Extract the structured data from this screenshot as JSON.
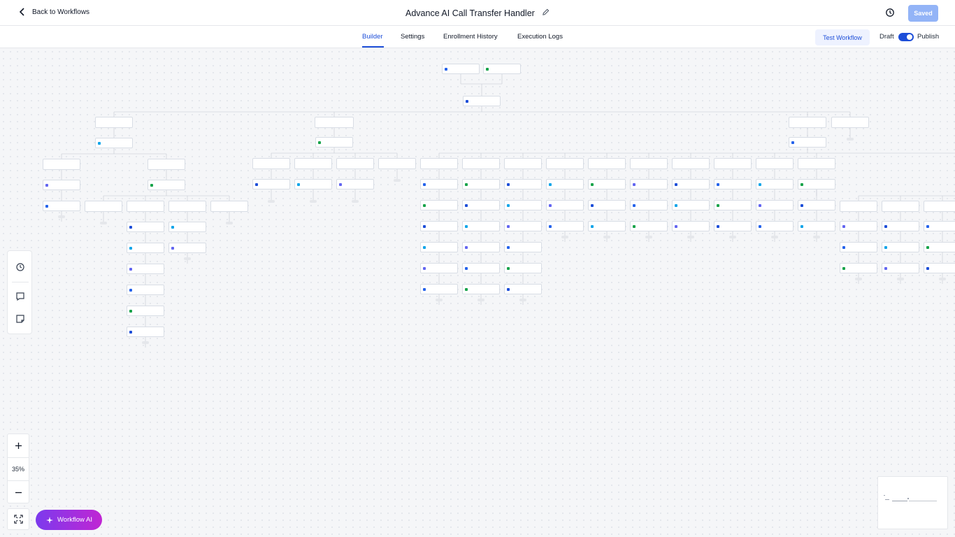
{
  "header": {
    "back_label": "Back to Workflows",
    "workflow_title": "Advance AI Call Transfer Handler",
    "saved_label": "Saved"
  },
  "tabs": [
    {
      "label": "Builder",
      "active": true
    },
    {
      "label": "Settings",
      "active": false
    },
    {
      "label": "Enrollment History",
      "active": false
    },
    {
      "label": "Execution Logs",
      "active": false
    }
  ],
  "actions": {
    "test_label": "Test Workflow",
    "draft_label": "Draft",
    "publish_label": "Publish",
    "published_toggle_on": true
  },
  "canvas": {
    "zoom_label": "35%",
    "zoom_in_icon": "plus-icon",
    "zoom_out_icon": "minus-icon"
  },
  "ai": {
    "label": "Workflow AI"
  },
  "colors": {
    "accent": "#1d4ed8",
    "saved_bg": "#93b4f7",
    "ai_gradient_start": "#7c3aed",
    "ai_gradient_end": "#c026d3"
  }
}
